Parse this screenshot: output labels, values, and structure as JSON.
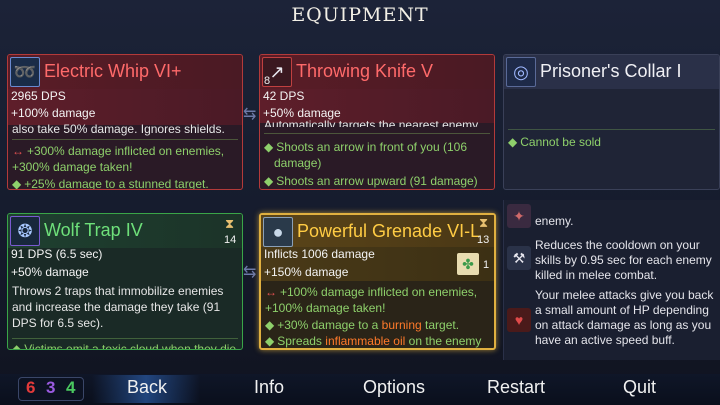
{
  "header": {
    "title": "EQUIPMENT"
  },
  "cards": {
    "whip": {
      "name": "Electric Whip VI+",
      "dps": "2965 DPS",
      "damage": "+100% damage",
      "desc": "also take 50% damage. Ignores shields.",
      "bullets": [
        "+300% damage inflicted on enemies,",
        "+300% damage taken!",
        "+25% damage to a stunned target."
      ],
      "color": "#c53030"
    },
    "knife": {
      "name": "Throwing Knife V",
      "level": "8",
      "dps": "42 DPS",
      "damage": "+50% damage",
      "desc": "Automatically targets the nearest enemy.",
      "bullets": [
        "Shoots an arrow in front of you (106",
        "damage)",
        "Shoots an arrow upward (91 damage)"
      ],
      "color": "#c53030"
    },
    "collar": {
      "name": "Prisoner's Collar I",
      "bullets": [
        "Cannot be sold"
      ]
    },
    "trap": {
      "name": "Wolf Trap IV",
      "cooldown": "14",
      "dps": "91 DPS (6.5 sec)",
      "damage": "+50% damage",
      "desc": "Throws 2 traps that immobilize enemies and increase the damage they take (91 DPS for 6.5 sec).",
      "bullets": [
        "Victims emit a toxic cloud when they die"
      ],
      "color": "#3aa548"
    },
    "grenade": {
      "name": "Powerful Grenade VI-L",
      "cooldown": "13",
      "scroll_count": "1",
      "dps": "Inflicts 1006 damage",
      "damage": "+150% damage",
      "bullets": [
        "+100% damage inflicted on enemies,",
        "+100% damage taken!",
        "+30% damage to a",
        "burning",
        "target.",
        "Spreads",
        "inflammable oil",
        "on the enemy"
      ],
      "color": "#d4a22a"
    }
  },
  "side_panel": {
    "top_cut": "enemy.",
    "entries": [
      "Reduces the cooldown on your skills by 0.95 sec for each enemy killed in melee combat.",
      "Your melee attacks give you back a small amount of HP depending on attack damage as long as you have an active speed buff."
    ]
  },
  "scrolls": {
    "brutality": "6",
    "tactics": "3",
    "survival": "4"
  },
  "menu": {
    "back": "Back",
    "info": "Info",
    "options": "Options",
    "restart": "Restart",
    "quit": "Quit"
  },
  "colors": {
    "red": "#c53030",
    "purple": "#9a4ad0",
    "green": "#3aa548",
    "gold": "#d4a22a",
    "bullet_green": "#8ed06b",
    "burning": "#ff7a2a"
  }
}
